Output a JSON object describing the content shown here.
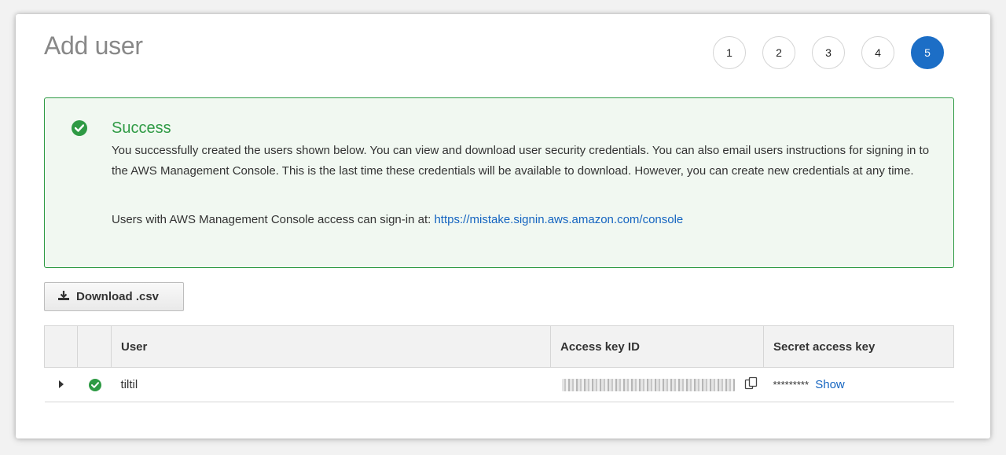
{
  "page": {
    "title": "Add user"
  },
  "steps": [
    {
      "label": "1",
      "active": false
    },
    {
      "label": "2",
      "active": false
    },
    {
      "label": "3",
      "active": false
    },
    {
      "label": "4",
      "active": false
    },
    {
      "label": "5",
      "active": true
    }
  ],
  "alert": {
    "title": "Success",
    "body": "You successfully created the users shown below. You can view and download user security credentials. You can also email users instructions for signing in to the AWS Management Console. This is the last time these credentials will be available to download. However, you can create new credentials at any time.",
    "signin_prefix": "Users with AWS Management Console access can sign-in at: ",
    "signin_url": "https://mistake.signin.aws.amazon.com/console",
    "color": "#2e9a44"
  },
  "download_button": {
    "label": "Download .csv",
    "icon": "download-icon"
  },
  "table": {
    "columns": [
      "User",
      "Access key ID",
      "Secret access key"
    ],
    "rows": [
      {
        "user": "tiltil",
        "access_key_id": "",
        "secret_masked": "*********",
        "show_label": "Show"
      }
    ]
  },
  "colors": {
    "accent": "#1c6ec6",
    "link": "#1464c0",
    "success": "#2e9a44"
  }
}
